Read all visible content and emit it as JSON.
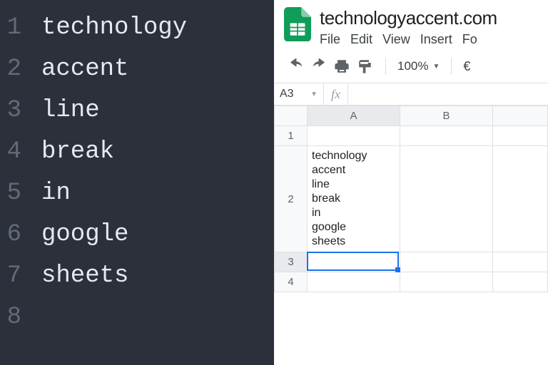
{
  "editor": {
    "lines": [
      {
        "n": "1",
        "text": "technology"
      },
      {
        "n": "2",
        "text": "accent"
      },
      {
        "n": "3",
        "text": "line"
      },
      {
        "n": "4",
        "text": "break"
      },
      {
        "n": "5",
        "text": "in"
      },
      {
        "n": "6",
        "text": "google"
      },
      {
        "n": "7",
        "text": "sheets"
      },
      {
        "n": "8",
        "text": ""
      }
    ]
  },
  "sheets": {
    "doc_title": "technologyaccent.com",
    "menu": {
      "file": "File",
      "edit": "Edit",
      "view": "View",
      "insert": "Insert",
      "format": "Fo"
    },
    "toolbar": {
      "zoom": "100%",
      "currency": "€"
    },
    "name_box": "A3",
    "fx_label": "fx",
    "formula_value": "",
    "columns": {
      "A": "A",
      "B": "B"
    },
    "rows": {
      "r1": "1",
      "r2": "2",
      "r3": "3",
      "r4": "4"
    },
    "cell_A2": "technology\naccent\nline\nbreak\nin\ngoogle\nsheets",
    "selected_cell": "A3"
  }
}
